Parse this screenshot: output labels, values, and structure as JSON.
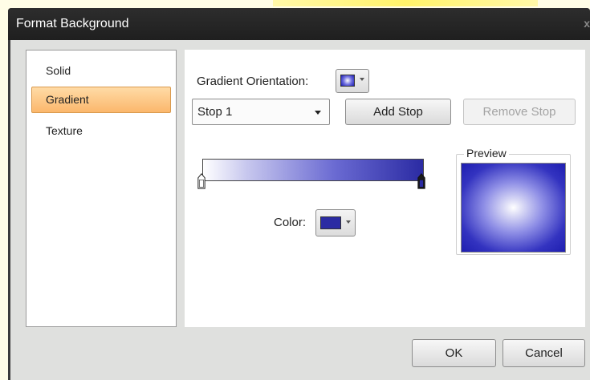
{
  "window": {
    "title": "Format Background",
    "close_glyph": "x"
  },
  "sidebar": {
    "items": [
      {
        "label": "Solid",
        "selected": false
      },
      {
        "label": "Gradient",
        "selected": true
      },
      {
        "label": "Texture",
        "selected": false
      }
    ]
  },
  "gradient": {
    "orientation_label": "Gradient Orientation:",
    "stop_select_value": "Stop 1",
    "add_stop_label": "Add Stop",
    "remove_stop_label": "Remove Stop",
    "remove_stop_enabled": false,
    "color_label": "Color:",
    "start_color": "#ffffff",
    "end_color": "#2b2ba3",
    "selected_stop_color": "#2b2ba3"
  },
  "preview": {
    "label": "Preview",
    "center_color": "#ffffff",
    "edge_color": "#1e1eb0"
  },
  "footer": {
    "ok_label": "OK",
    "cancel_label": "Cancel"
  },
  "icons": {
    "orientation": "radial-gradient-swatch-icon",
    "dropdown": "chevron-down-icon",
    "stop_marker": "gradient-stop-marker-icon"
  }
}
